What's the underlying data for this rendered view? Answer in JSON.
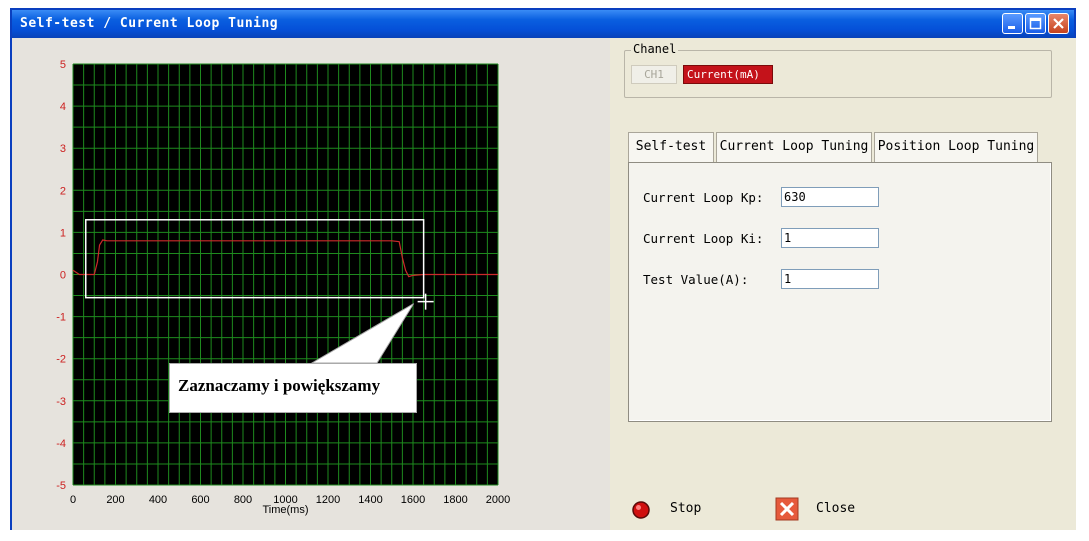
{
  "window": {
    "title": "Self-test / Current Loop Tuning"
  },
  "plot": {
    "xlabel": "Time(ms)",
    "callout": "Zaznaczamy i powiększamy"
  },
  "chart_data": {
    "type": "line",
    "xlabel": "Time(ms)",
    "ylabel": "",
    "xlim": [
      0,
      2000
    ],
    "ylim": [
      -5,
      5
    ],
    "x_ticks": [
      0,
      200,
      400,
      600,
      800,
      1000,
      1200,
      1400,
      1600,
      1800,
      2000
    ],
    "y_ticks": [
      5,
      4,
      3,
      2,
      1,
      0,
      -1,
      -2,
      -3,
      -4,
      -5
    ],
    "grid": true,
    "background": "#000000",
    "grid_color": "#1e8a1e",
    "series": [
      {
        "color": "#cc2a2a",
        "x": [
          0,
          30,
          50,
          100,
          115,
          125,
          140,
          160,
          400,
          800,
          1200,
          1500,
          1535,
          1550,
          1565,
          1580,
          1600,
          1650,
          2000
        ],
        "y": [
          0.1,
          0.0,
          0.0,
          0.0,
          0.3,
          0.7,
          0.82,
          0.8,
          0.8,
          0.8,
          0.8,
          0.8,
          0.78,
          0.4,
          0.1,
          -0.05,
          -0.02,
          0.0,
          0.0
        ]
      }
    ],
    "selection": {
      "x": [
        60,
        1650
      ],
      "y": [
        -0.55,
        1.3
      ]
    }
  },
  "chanel": {
    "legend": "Chanel",
    "ch1_label": "CH1",
    "current_label": "Current(mA)",
    "current_color": "#c4121a"
  },
  "tabs": [
    {
      "label": "Self-test"
    },
    {
      "label": "Current Loop Tuning"
    },
    {
      "label": "Position Loop Tuning"
    }
  ],
  "fields": [
    {
      "label": "Current Loop Kp:",
      "value": "630"
    },
    {
      "label": "Current Loop Ki:",
      "value": "1"
    },
    {
      "label": "Test Value(A):",
      "value": "1"
    }
  ],
  "actions": {
    "stop_label": "Stop",
    "close_label": "Close",
    "stop_icon": "red-circle-icon",
    "close_icon": "x-icon"
  },
  "titlebar_buttons": [
    "minimize-icon",
    "maximize-icon",
    "close-icon"
  ]
}
